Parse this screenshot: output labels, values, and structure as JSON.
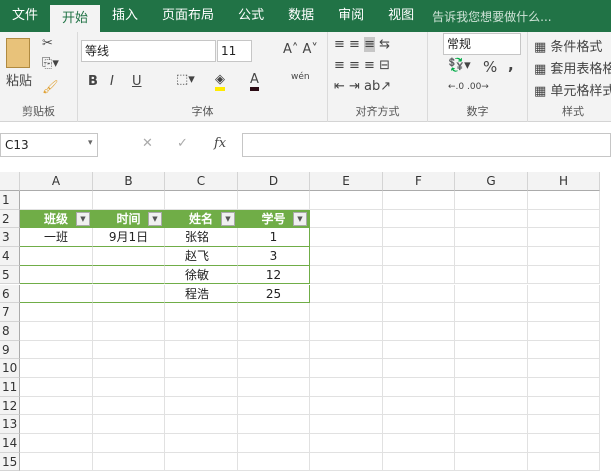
{
  "tabs": [
    "文件",
    "开始",
    "插入",
    "页面布局",
    "公式",
    "数据",
    "审阅",
    "视图"
  ],
  "tell_me": "告诉我您想要做什么...",
  "ribbon": {
    "clipboard": {
      "paste": "粘贴",
      "label": "剪贴板"
    },
    "font": {
      "name": "等线",
      "size": "11",
      "label": "字体",
      "bold": "B",
      "italic": "I",
      "underline": "U",
      "phonetic": "wén"
    },
    "alignment": {
      "label": "对齐方式"
    },
    "number": {
      "format": "常规",
      "percent": "%",
      "comma": ",",
      "label": "数字"
    },
    "styles": {
      "conditional": "条件格式",
      "table": "套用表格格式",
      "cell": "单元格样式",
      "label": "样式"
    }
  },
  "formula_bar": {
    "name_box": "C13",
    "fx": "fx",
    "value": ""
  },
  "columns": [
    "A",
    "B",
    "C",
    "D",
    "E",
    "F",
    "G",
    "H"
  ],
  "rows": [
    "1",
    "2",
    "3",
    "4",
    "5",
    "6",
    "7",
    "8",
    "9",
    "10",
    "11",
    "12",
    "13",
    "14",
    "15"
  ],
  "table": {
    "headers": [
      "班级",
      "时间",
      "姓名",
      "学号"
    ],
    "rows": [
      [
        "一班",
        "9月1日",
        "张铭",
        "1"
      ],
      [
        "",
        "",
        "赵飞",
        "3"
      ],
      [
        "",
        "",
        "徐敏",
        "12"
      ],
      [
        "",
        "",
        "程浩",
        "25"
      ]
    ]
  },
  "colors": {
    "accent": "#217346",
    "table_header": "#70ad47"
  }
}
